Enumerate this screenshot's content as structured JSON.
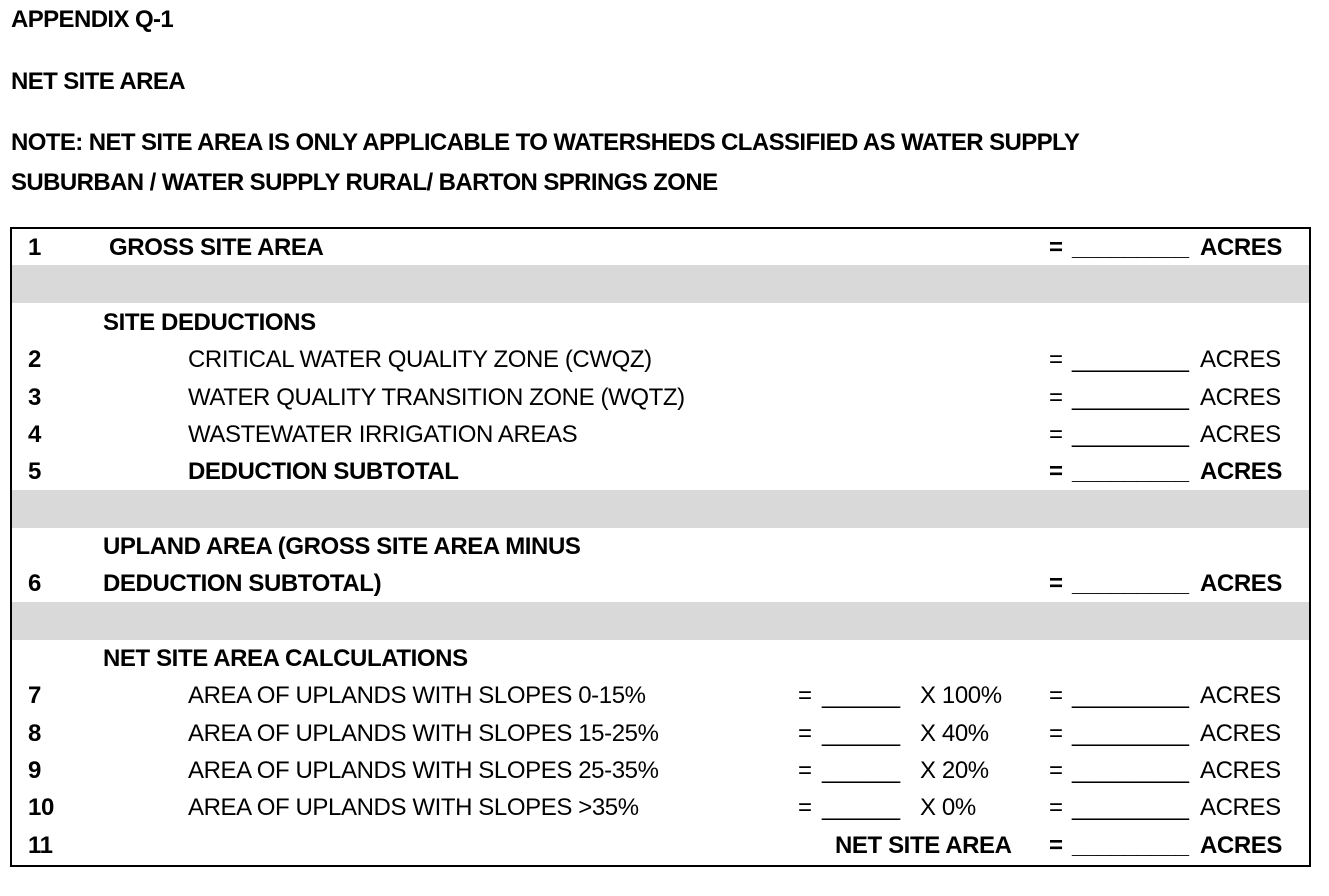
{
  "header": {
    "appendix": "APPENDIX Q-1",
    "title": "NET SITE AREA",
    "note_line1": "NOTE: NET SITE AREA IS ONLY APPLICABLE TO WATERSHEDS CLASSIFIED AS WATER SUPPLY",
    "note_line2": "SUBURBAN / WATER SUPPLY RURAL/ BARTON SPRINGS ZONE"
  },
  "form": {
    "equals": "=",
    "blank_long": "_________",
    "blank_short": "______",
    "unit": "ACRES",
    "rows": [
      {
        "num": "1",
        "label": "GROSS SITE AREA"
      },
      {
        "section": "SITE DEDUCTIONS"
      },
      {
        "num": "2",
        "label": "CRITICAL WATER QUALITY ZONE (CWQZ)"
      },
      {
        "num": "3",
        "label": "WATER QUALITY TRANSITION ZONE (WQTZ)"
      },
      {
        "num": "4",
        "label": "WASTEWATER IRRIGATION AREAS"
      },
      {
        "num": "5",
        "label": "DEDUCTION SUBTOTAL"
      },
      {
        "label_line1": "UPLAND AREA (GROSS SITE AREA MINUS",
        "num": "6",
        "label": "DEDUCTION SUBTOTAL)"
      },
      {
        "section": "NET SITE AREA CALCULATIONS"
      },
      {
        "num": "7",
        "label": "AREA OF UPLANDS WITH SLOPES 0-15%",
        "multiplier": "X 100%"
      },
      {
        "num": "8",
        "label": "AREA OF UPLANDS WITH SLOPES 15-25%",
        "multiplier": "X 40%"
      },
      {
        "num": "9",
        "label": "AREA OF UPLANDS WITH SLOPES 25-35%",
        "multiplier": "X 20%"
      },
      {
        "num": "10",
        "label": "AREA OF UPLANDS WITH SLOPES >35%",
        "multiplier": "X 0%"
      },
      {
        "num": "11",
        "label": "NET SITE AREA"
      }
    ]
  }
}
